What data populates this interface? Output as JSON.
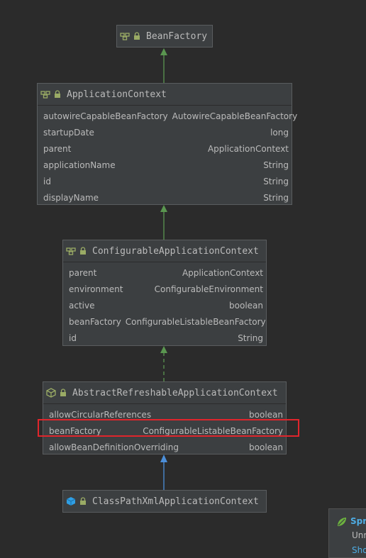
{
  "diagram": {
    "nodes": [
      {
        "title": "BeanFactory",
        "kind": "interface",
        "fields": []
      },
      {
        "title": "ApplicationContext",
        "kind": "interface",
        "fields": [
          {
            "name": "autowireCapableBeanFactory",
            "type": "AutowireCapableBeanFactory"
          },
          {
            "name": "startupDate",
            "type": "long"
          },
          {
            "name": "parent",
            "type": "ApplicationContext"
          },
          {
            "name": "applicationName",
            "type": "String"
          },
          {
            "name": "id",
            "type": "String"
          },
          {
            "name": "displayName",
            "type": "String"
          }
        ]
      },
      {
        "title": "ConfigurableApplicationContext",
        "kind": "interface",
        "fields": [
          {
            "name": "parent",
            "type": "ApplicationContext"
          },
          {
            "name": "environment",
            "type": "ConfigurableEnvironment"
          },
          {
            "name": "active",
            "type": "boolean"
          },
          {
            "name": "beanFactory",
            "type": "ConfigurableListableBeanFactory"
          },
          {
            "name": "id",
            "type": "String"
          }
        ]
      },
      {
        "title": "AbstractRefreshableApplicationContext",
        "kind": "abstract-class",
        "fields": [
          {
            "name": "allowCircularReferences",
            "type": "boolean"
          },
          {
            "name": "beanFactory",
            "type": "ConfigurableListableBeanFactory"
          },
          {
            "name": "allowBeanDefinitionOverriding",
            "type": "boolean"
          }
        ]
      },
      {
        "title": "ClassPathXmlApplicationContext",
        "kind": "class",
        "fields": []
      }
    ],
    "edges": [
      {
        "from": "ApplicationContext",
        "to": "BeanFactory",
        "style": "solid",
        "color": "#5a9650"
      },
      {
        "from": "ConfigurableApplicationContext",
        "to": "ApplicationContext",
        "style": "solid",
        "color": "#5a9650"
      },
      {
        "from": "AbstractRefreshableApplicationContext",
        "to": "ConfigurableApplicationContext",
        "style": "dashed",
        "color": "#5a9650"
      },
      {
        "from": "ClassPathXmlApplicationContext",
        "to": "AbstractRefreshableApplicationContext",
        "style": "solid",
        "color": "#4c8fd9"
      }
    ],
    "highlighted_field": {
      "node": "AbstractRefreshableApplicationContext",
      "field": "beanFactory",
      "color": "#e0252c"
    }
  },
  "notification": {
    "title": "Spr",
    "body": "Unr",
    "link": "Sho"
  },
  "colors": {
    "background": "#2b2b2b",
    "node_fill": "#3c3f41",
    "interface_icon": "#9aab65",
    "lock_icon": "#9aab65",
    "class_icon": "#2f9fe5",
    "inheritance_arrow": "#5a9650",
    "implementation_arrow": "#4c8fd9"
  }
}
